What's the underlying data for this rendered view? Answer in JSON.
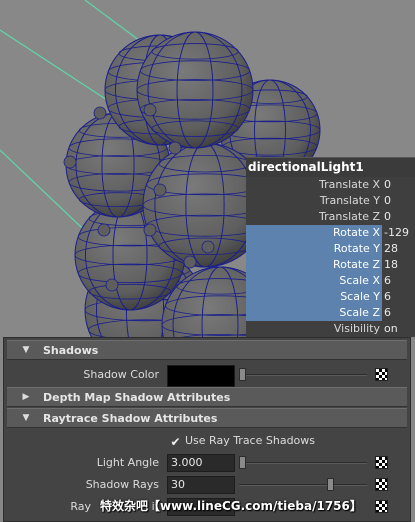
{
  "channel_box": {
    "title": "directionalLight1",
    "rows": [
      {
        "label": "Translate X",
        "value": "0",
        "selected": false
      },
      {
        "label": "Translate Y",
        "value": "0",
        "selected": false
      },
      {
        "label": "Translate Z",
        "value": "0",
        "selected": false
      },
      {
        "label": "Rotate X",
        "value": "-129",
        "selected": true
      },
      {
        "label": "Rotate Y",
        "value": "28",
        "selected": true
      },
      {
        "label": "Rotate Z",
        "value": "18",
        "selected": true
      },
      {
        "label": "Scale X",
        "value": "6",
        "selected": true
      },
      {
        "label": "Scale Y",
        "value": "6",
        "selected": true
      },
      {
        "label": "Scale Z",
        "value": "6",
        "selected": true
      },
      {
        "label": "Visibility",
        "value": "on",
        "selected": false
      }
    ]
  },
  "attribute_editor": {
    "shadows_header": "Shadows",
    "shadow_color_label": "Shadow Color",
    "shadow_color": "#000000",
    "depth_map_header": "Depth Map Shadow Attributes",
    "raytrace_header": "Raytrace Shadow Attributes",
    "use_ray_trace_label": "Use Ray Trace Shadows",
    "use_ray_trace_checked": true,
    "light_angle_label": "Light Angle",
    "light_angle_value": "3.000",
    "shadow_rays_label": "Shadow Rays",
    "shadow_rays_value": "30",
    "ray_depth_limit_label": "Ray Depth Limit",
    "ray_depth_limit_label_visible": "Ray",
    "ray_depth_limit_label_tail": "it"
  },
  "colors": {
    "viewport_bg": "#888888",
    "sphere_fill": "#5e5e5e",
    "wireframe": "#1a1f8c",
    "light_line": "#5ed8a8",
    "selection": "#5d82ad"
  },
  "icons": {
    "expanded": "triangle-down-icon",
    "collapsed": "triangle-right-icon",
    "map_button": "checker-map-icon"
  },
  "watermark": "特效杂吧【www.lineCG.com/tieba/1756】"
}
